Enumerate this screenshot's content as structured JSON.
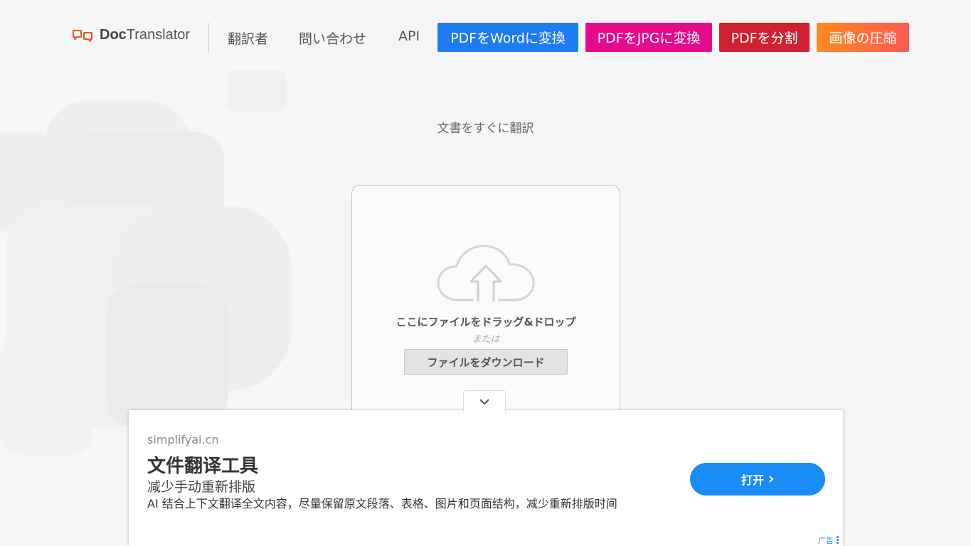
{
  "header": {
    "logo_bold": "Doc",
    "logo_rest": "Translator",
    "nav_links": [
      "翻訳者",
      "問い合わせ",
      "API"
    ],
    "nav_buttons": [
      {
        "label": "PDFをWordに変換",
        "color": "#1e7cf2"
      },
      {
        "label": "PDFをJPGに変換",
        "color": "#e60b8c"
      },
      {
        "label": "PDFを分割",
        "color": "#cf2130"
      },
      {
        "label": "画像の圧縮",
        "color": "#ff7a2a"
      }
    ]
  },
  "hero": {
    "tagline": "文書をすぐに翻訳"
  },
  "upload": {
    "drop_text": "ここにファイルをドラッグ&ドロップ",
    "or_text": "または",
    "download_label": "ファイルをダウンロード",
    "cloud_icon": "cloud-upload-icon"
  },
  "ad": {
    "domain": "simplifyai.cn",
    "title": "文件翻译工具",
    "subtitle": "减少手动重新排版",
    "description": "AI 结合上下文翻译全文内容，尽量保留原文段落、表格、图片和页面结构，减少重新排版时间",
    "open_label": "打开",
    "ad_label": "广告",
    "accent": "#1a8cf5"
  },
  "colors": {
    "logo_accent": "#e2572a",
    "background": "#f6f6f6"
  }
}
